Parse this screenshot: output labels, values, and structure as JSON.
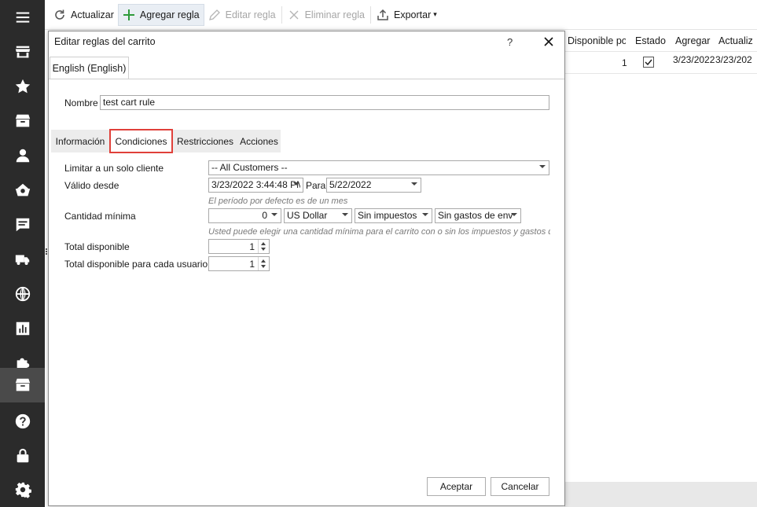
{
  "sidebar": {
    "items": [
      {
        "icon": "menu-icon"
      },
      {
        "icon": "store-icon"
      },
      {
        "icon": "star-icon"
      },
      {
        "icon": "archive-icon"
      },
      {
        "icon": "person-icon"
      },
      {
        "icon": "basket-icon"
      },
      {
        "icon": "chat-icon"
      },
      {
        "icon": "truck-icon"
      },
      {
        "icon": "globe-icon"
      },
      {
        "icon": "report-icon"
      },
      {
        "icon": "puzzle-icon"
      },
      {
        "icon": "cart-rules-icon",
        "active": true
      },
      {
        "icon": "help-icon"
      },
      {
        "icon": "lock-icon"
      },
      {
        "icon": "gear-icon"
      }
    ]
  },
  "toolbar": {
    "refresh_label": "Actualizar",
    "add_label": "Agregar regla",
    "edit_label": "Editar regla",
    "delete_label": "Eliminar regla",
    "export_label": "Exportar"
  },
  "grid": {
    "columns": [
      "Disponible po",
      "Estado",
      "Agregar",
      "Actualiz"
    ],
    "row": {
      "available": "1",
      "status_checked": true,
      "added": "3/23/2022",
      "updated": "3/23/202"
    }
  },
  "dialog": {
    "title": "Editar reglas del carrito",
    "help": "?",
    "language_tab": "English (English)",
    "name_label": "Nombre",
    "name_value": "test cart rule",
    "tabs": [
      "Información",
      "Condiciones",
      "Restricciones",
      "Acciones"
    ],
    "active_tab": "Condiciones",
    "conditions": {
      "customer_label": "Limitar a un solo cliente",
      "customer_value": "-- All Customers --",
      "valid_from_label": "Válido desde",
      "valid_from_value": "3/23/2022 3:44:48 PM",
      "to_label": "Para",
      "valid_to_value": "5/22/2022",
      "period_hint": "El período por defecto es de un mes",
      "min_amount_label": "Cantidad mínima",
      "min_amount_value": "0",
      "currency_value": "US Dollar",
      "tax_value": "Sin impuestos",
      "shipping_value": "Sin gastos de env",
      "min_amount_hint": "Usted puede elegir una cantidad mínima para el carrito con o sin los impuestos y gastos de",
      "total_available_label": "Total disponible",
      "total_available_value": "1",
      "total_per_user_label": "Total disponible para cada usuario",
      "total_per_user_value": "1"
    },
    "accept_label": "Aceptar",
    "cancel_label": "Cancelar"
  }
}
